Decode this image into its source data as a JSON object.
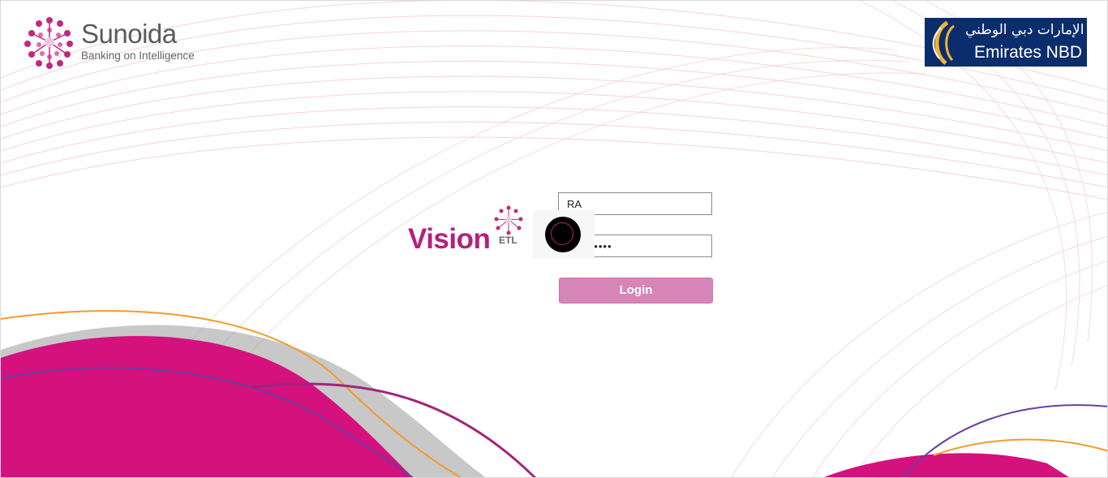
{
  "header": {
    "left_logo": {
      "name": "Sunoida",
      "tagline": "Banking on Intelligence"
    },
    "right_logo": {
      "arabic": "بنك الإمارات دبي الوطني",
      "latin": "Emirates NBD"
    }
  },
  "login": {
    "product": {
      "name": "Vision",
      "suffix": "ETL"
    },
    "username": {
      "value": "RA"
    },
    "password": {
      "value": "••••••••••"
    },
    "submit_label": "Login",
    "loading": true
  },
  "colors": {
    "brand_magenta": "#b5207d",
    "button_pink": "#d785b8",
    "enbd_navy": "#0a2d6e",
    "accent_orange": "#f39a2b",
    "accent_purple": "#6b3fa0"
  },
  "icons": {
    "sunoida_mark": "sunoida-flower-icon",
    "vision_mark": "vision-flower-icon",
    "enbd_mark": "emirates-nbd-emblem-icon",
    "spinner": "loading-spinner-icon"
  }
}
